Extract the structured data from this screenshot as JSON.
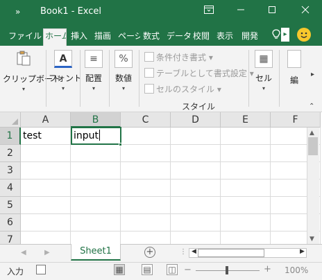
{
  "titlebar": {
    "quick_access": "»",
    "title": "Book1 - Excel",
    "controls": [
      "⧉",
      "—",
      "☐",
      "✕"
    ]
  },
  "tabs": [
    {
      "label": "ファイル",
      "active": false
    },
    {
      "label": "ホーム",
      "active": true
    },
    {
      "label": "挿入",
      "active": false
    },
    {
      "label": "描画",
      "active": false
    },
    {
      "label": "ページ",
      "active": false
    },
    {
      "label": "数式",
      "active": false
    },
    {
      "label": "データ",
      "active": false
    },
    {
      "label": "校閲",
      "active": false
    },
    {
      "label": "表示",
      "active": false
    },
    {
      "label": "開発",
      "active": false
    }
  ],
  "tab_overflow": "▸",
  "ribbon": {
    "clipboard": {
      "label": "クリップボード",
      "icon": "📋"
    },
    "font": {
      "label": "フォント",
      "icon": "A"
    },
    "alignment": {
      "label": "配置",
      "icon": "≡"
    },
    "number": {
      "label": "数値",
      "icon": "%"
    },
    "styles": {
      "conditional": "条件付き書式",
      "table": "テーブルとして書式設定",
      "cell_styles": "セルのスタイル",
      "group_label": "スタイル"
    },
    "cells": {
      "label": "セル",
      "icon": "▦"
    },
    "edit": {
      "label": "編"
    }
  },
  "grid": {
    "columns": [
      "A",
      "B",
      "C",
      "D",
      "E",
      "F"
    ],
    "rows": [
      "1",
      "2",
      "3",
      "4",
      "5",
      "6",
      "7"
    ],
    "selected_column": "B",
    "selected_row": "1",
    "cells": {
      "A1": "test",
      "B1": "input"
    }
  },
  "sheets": {
    "tabs": [
      "Sheet1"
    ],
    "active": "Sheet1",
    "add_label": "+"
  },
  "status": {
    "mode": "入力",
    "zoom": "100%"
  }
}
